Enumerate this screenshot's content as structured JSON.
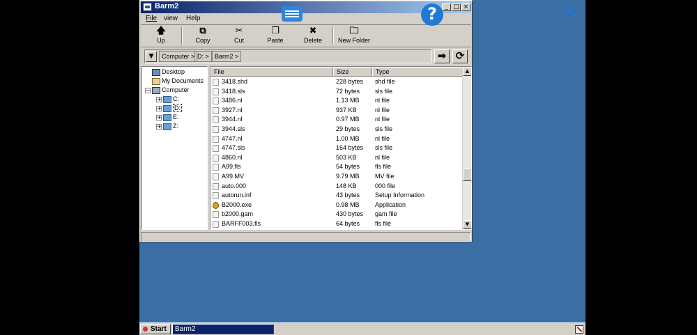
{
  "window": {
    "title": "Barm2",
    "controls": {
      "minimize": "_",
      "maximize": "□",
      "close": "×"
    }
  },
  "overlay": {
    "help": "?",
    "close": "✕"
  },
  "menu": {
    "file": "File",
    "view": "view",
    "help": "Help"
  },
  "toolbar": {
    "up": {
      "icon": "up-arrow-icon",
      "label": "Up"
    },
    "copy": {
      "icon": "copy-icon",
      "label": "Copy"
    },
    "cut": {
      "icon": "scissors-icon",
      "label": "Cut"
    },
    "paste": {
      "icon": "paste-icon",
      "label": "Paste"
    },
    "delete": {
      "icon": "delete-x-icon",
      "label": "Delete"
    },
    "new_folder": {
      "icon": "new-folder-icon",
      "label": "New Folder"
    }
  },
  "address": {
    "crumbs": [
      "Computer >",
      "D: >",
      "Barm2 >"
    ]
  },
  "tree": {
    "desktop": "Desktop",
    "my_documents": "My Documents",
    "computer": "Computer",
    "drives": [
      "C:",
      "D:",
      "E:",
      "Z:"
    ]
  },
  "columns": {
    "file": "File",
    "size": "Size",
    "type": "Type"
  },
  "files": [
    {
      "name": "3418.shd",
      "size": "228 bytes",
      "type": "shd file"
    },
    {
      "name": "3418.sls",
      "size": "72 bytes",
      "type": "sls file"
    },
    {
      "name": "3486.nl",
      "size": "1.13 MB",
      "type": "nl file"
    },
    {
      "name": "3927.nl",
      "size": "937 KB",
      "type": "nl file"
    },
    {
      "name": "3944.nl",
      "size": "0.97 MB",
      "type": "nl file"
    },
    {
      "name": "3944.sls",
      "size": "29 bytes",
      "type": "sls file"
    },
    {
      "name": "4747.nl",
      "size": "1.00 MB",
      "type": "nl file"
    },
    {
      "name": "4747.sls",
      "size": "164 bytes",
      "type": "sls file"
    },
    {
      "name": "4860.nl",
      "size": "503 KB",
      "type": "nl file"
    },
    {
      "name": "A99.fls",
      "size": "54 bytes",
      "type": "fls file"
    },
    {
      "name": "A99.MV",
      "size": "9.79 MB",
      "type": "MV file"
    },
    {
      "name": "auto.000",
      "size": "148 KB",
      "type": "000 file"
    },
    {
      "name": "autorun.inf",
      "size": "43 bytes",
      "type": "Setup Information"
    },
    {
      "name": "B2000.exe",
      "size": "0.98 MB",
      "type": "Application"
    },
    {
      "name": "b2000.gam",
      "size": "430 bytes",
      "type": "gam file"
    },
    {
      "name": "BARFF003.fls",
      "size": "64 bytes",
      "type": "fls file"
    }
  ],
  "taskbar": {
    "start": "Start",
    "task": "Barm2"
  }
}
